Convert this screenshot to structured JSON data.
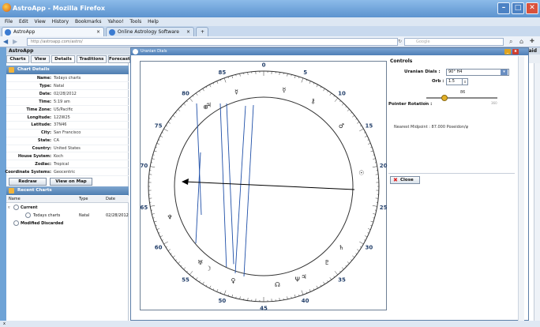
{
  "browser": {
    "title": "AstroApp - Mozilla Firefox",
    "menu": [
      "File",
      "Edit",
      "View",
      "History",
      "Bookmarks",
      "Yahoo!",
      "Tools",
      "Help"
    ],
    "tabs": [
      {
        "label": "AstroApp"
      },
      {
        "label": "Online Astrology Software"
      }
    ],
    "new_tab": "+",
    "url": "http://astroapp.com/astro/",
    "search_placeholder": "Google"
  },
  "app": {
    "title": "AstroApp",
    "right_fragment": "aid",
    "tabs": [
      "Charts",
      "View",
      "Details",
      "Traditions",
      "Forecast"
    ]
  },
  "chart_details": {
    "header": "Chart Details",
    "fields": [
      {
        "label": "Name:",
        "value": "Todays charts"
      },
      {
        "label": "Type:",
        "value": "Natal"
      },
      {
        "label": "Date:",
        "value": "02/28/2012"
      },
      {
        "label": "Time:",
        "value": "5:19 am"
      },
      {
        "label": "Time Zone:",
        "value": "US/Pacific"
      },
      {
        "label": "Longitude:",
        "value": "122W25"
      },
      {
        "label": "Latitude:",
        "value": "37N46"
      },
      {
        "label": "City:",
        "value": "San Francisco"
      },
      {
        "label": "State:",
        "value": "CA"
      },
      {
        "label": "Country:",
        "value": "United States"
      },
      {
        "label": "House System:",
        "value": "Koch"
      },
      {
        "label": "Zodiac:",
        "value": "Tropical"
      },
      {
        "label": "Coordinate Systems:",
        "value": "Geocentric"
      }
    ],
    "redraw": "Redraw",
    "view_map": "View on Map"
  },
  "recent_charts": {
    "header": "Recent Charts",
    "columns": [
      "Name",
      "Type",
      "Date"
    ],
    "current_group": "Current",
    "rows": [
      {
        "name": "Todays charts",
        "type": "Natal",
        "date": "02/28/2012"
      }
    ],
    "modified_group": "Modified Discarded"
  },
  "dialog": {
    "title": "Uranian Dials",
    "minimize": "_",
    "close_x": "x",
    "controls_title": "Controls",
    "uranian_dials_label": "Uranian Dials :",
    "uranian_dials_value": "90° H4",
    "orb_label": "Orb :",
    "orb_value": "1.5",
    "slider_value": "86",
    "slider_min": "0",
    "slider_max": "360",
    "pointer_rotation_label": "Pointer Rotation :",
    "midpoint_text": "Nearest Midpoint : 87.000 Poseidon/ψ",
    "close_button": "Close"
  },
  "dial": {
    "numbers": [
      "0",
      "5",
      "10",
      "15",
      "20",
      "25",
      "30",
      "35",
      "40",
      "45",
      "50",
      "55",
      "60",
      "65",
      "70",
      "75",
      "80",
      "85"
    ],
    "glyphs": [
      {
        "name": "neptune-glyph",
        "char": "♆",
        "deg": 63
      },
      {
        "name": "uranus-glyph",
        "char": "♅",
        "deg": 55
      },
      {
        "name": "cupido-glyph",
        "char": "⊕",
        "deg": 81
      },
      {
        "name": "glyph-4",
        "char": "☿",
        "deg": 86
      },
      {
        "name": "glyph-5",
        "char": "♃",
        "deg": 81.5
      },
      {
        "name": "chiron-glyph",
        "char": "⚷",
        "deg": 7.5
      },
      {
        "name": "mars-glyph",
        "char": "♂",
        "deg": 13
      },
      {
        "name": "mercury-glyph",
        "char": "☿",
        "deg": 3
      },
      {
        "name": "sun-glyph",
        "char": "☉",
        "deg": 20.5
      },
      {
        "name": "pluto-glyph",
        "char": "♇",
        "deg": 35
      },
      {
        "name": "node-glyph",
        "char": "☊",
        "deg": 43
      },
      {
        "name": "venus-glyph",
        "char": "♀",
        "deg": 49.5
      },
      {
        "name": "saturn-glyph",
        "char": "♄",
        "deg": 32
      },
      {
        "name": "moon-glyph",
        "char": "☽",
        "deg": 53.5
      },
      {
        "name": "jupiter-glyph",
        "char": "♃",
        "deg": 39
      },
      {
        "name": "poseidon-glyph",
        "char": "Ψ",
        "deg": 40
      }
    ]
  },
  "status": "x"
}
